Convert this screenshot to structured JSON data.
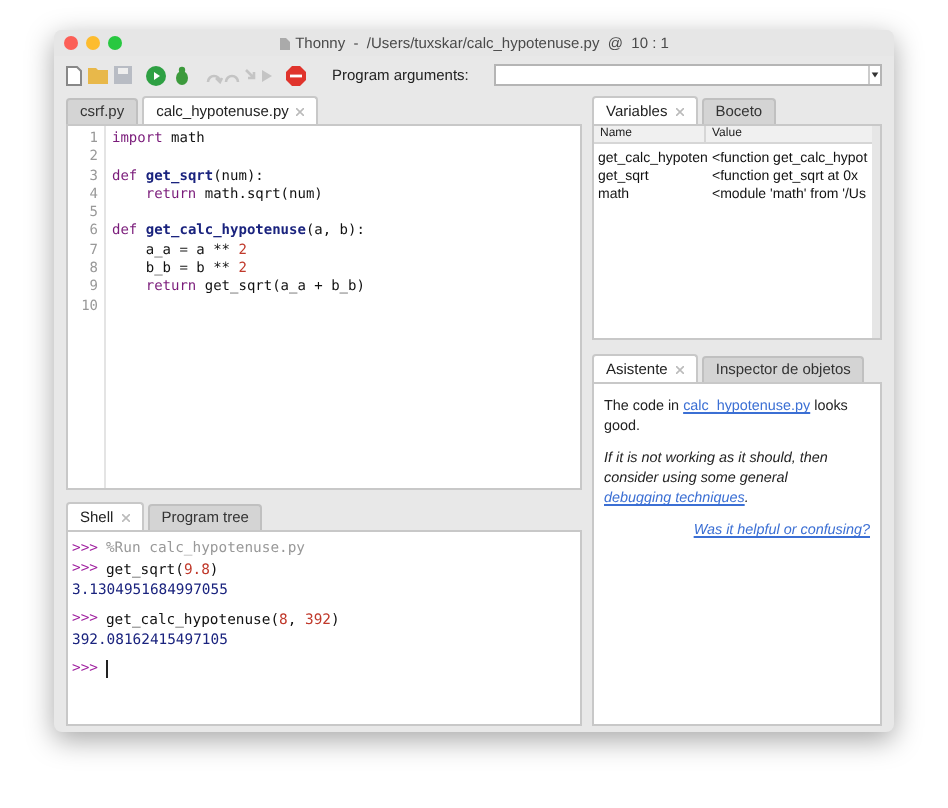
{
  "window": {
    "title": "Thonny  -  /Users/tuxskar/calc_hypotenuse.py  @  10 : 1"
  },
  "toolbar": {
    "program_arguments_label": "Program arguments:"
  },
  "editor_tabs": [
    {
      "label": "csrf.py",
      "selected": false
    },
    {
      "label": "calc_hypotenuse.py",
      "selected": true
    }
  ],
  "code": [
    {
      "number": "1",
      "tokens": [
        {
          "kind": "keyword",
          "text": "import"
        },
        {
          "kind": "plain",
          "text": " math"
        }
      ]
    },
    {
      "number": "2"
    },
    {
      "number": "3",
      "tokens": [
        {
          "kind": "keyword",
          "text": "def"
        },
        {
          "kind": "defname",
          "text": " get_sqrt"
        },
        {
          "kind": "plain",
          "text": "(num):"
        }
      ]
    },
    {
      "number": "4",
      "tokens": [
        {
          "kind": "keyword",
          "text": "    return"
        },
        {
          "kind": "plain",
          "text": " math.sqrt(num)"
        }
      ]
    },
    {
      "number": "5"
    },
    {
      "number": "6",
      "tokens": [
        {
          "kind": "keyword",
          "text": "def"
        },
        {
          "kind": "defname",
          "text": " get_calc_hypotenuse"
        },
        {
          "kind": "plain",
          "text": "(a, b):"
        }
      ]
    },
    {
      "number": "7",
      "tokens": [
        {
          "kind": "plain",
          "text": "    a_a = a ** "
        },
        {
          "kind": "number",
          "text": "2"
        }
      ]
    },
    {
      "number": "8",
      "tokens": [
        {
          "kind": "plain",
          "text": "    b_b = b ** "
        },
        {
          "kind": "number",
          "text": "2"
        }
      ]
    },
    {
      "number": "9",
      "tokens": [
        {
          "kind": "keyword",
          "text": "    return"
        },
        {
          "kind": "plain",
          "text": " get_sqrt(a_a + b_b)"
        }
      ]
    },
    {
      "number": "10"
    }
  ],
  "shell_tabs": [
    {
      "label": "Shell",
      "selected": true
    },
    {
      "label": "Program tree",
      "selected": false
    }
  ],
  "shell": [
    {
      "kind": "input",
      "prompt": ">>>",
      "tokens": [
        {
          "kind": "run",
          "text": "%Run calc_hypotenuse.py"
        }
      ]
    },
    {
      "kind": "input",
      "prompt": ">>>",
      "tokens": [
        {
          "kind": "plain",
          "text": "get_sqrt("
        },
        {
          "kind": "number",
          "text": "9.8"
        },
        {
          "kind": "plain",
          "text": ")"
        }
      ]
    },
    {
      "kind": "output",
      "text": "3.1304951684997055"
    },
    {
      "kind": "input",
      "prompt": ">>>",
      "tokens": [
        {
          "kind": "plain",
          "text": "get_calc_hypotenuse("
        },
        {
          "kind": "number",
          "text": "8"
        },
        {
          "kind": "plain",
          "text": ", "
        },
        {
          "kind": "number",
          "text": "392"
        },
        {
          "kind": "plain",
          "text": ")"
        }
      ]
    },
    {
      "kind": "output",
      "text": "392.08162415497105"
    },
    {
      "kind": "cursor",
      "prompt": ">>>"
    }
  ],
  "variables_tabs": [
    {
      "label": "Variables",
      "selected": true
    },
    {
      "label": "Boceto",
      "selected": false
    }
  ],
  "variables": {
    "columns": [
      "Name",
      "Value"
    ],
    "rows": [
      [
        "get_calc_hypoten",
        "<function get_calc_hypot"
      ],
      [
        "get_sqrt",
        "<function get_sqrt at 0x"
      ],
      [
        "math",
        "<module 'math' from '/Us"
      ]
    ]
  },
  "assistant_tabs": [
    {
      "label": "Asistente",
      "selected": true
    },
    {
      "label": "Inspector de objetos",
      "selected": false
    }
  ],
  "assistant": [
    {
      "kind": "text",
      "parts": [
        {
          "kind": "text",
          "text": "The code in "
        },
        {
          "kind": "link",
          "text": "calc_hypotenuse.py"
        },
        {
          "kind": "text",
          "text": " looks good."
        }
      ]
    },
    {
      "kind": "note",
      "parts": [
        {
          "kind": "text",
          "text": "If it is not working as it should, then consider using some general "
        },
        {
          "kind": "link",
          "text": "debugging techniques"
        },
        {
          "kind": "text",
          "text": "."
        }
      ]
    },
    {
      "kind": "feedback",
      "parts": [
        {
          "kind": "link",
          "text": "Was it helpful or confusing?"
        }
      ]
    }
  ]
}
